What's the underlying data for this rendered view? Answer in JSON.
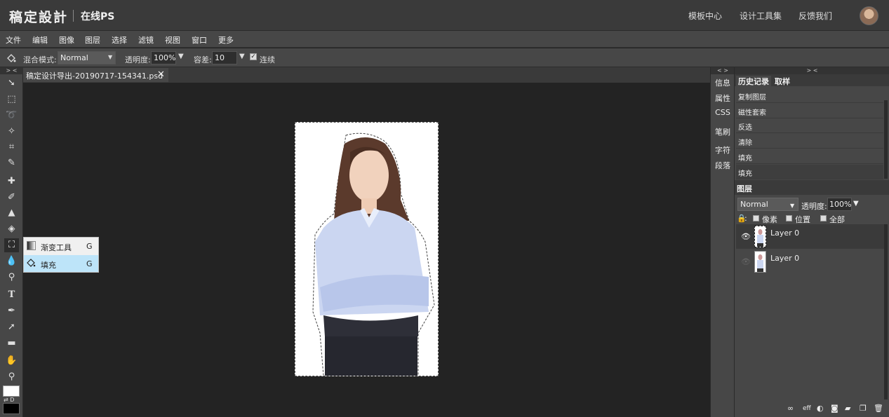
{
  "header": {
    "logo": "稿定設計",
    "subtitle": "在线PS",
    "links": [
      "模板中心",
      "设计工具集",
      "反馈我们"
    ]
  },
  "menu": [
    "文件",
    "编辑",
    "图像",
    "图层",
    "选择",
    "滤镜",
    "视图",
    "窗口",
    "更多"
  ],
  "options": {
    "blend_label": "混合模式:",
    "blend_value": "Normal",
    "opacity_label": "透明度:",
    "opacity_value": "100%",
    "tolerance_label": "容差:",
    "tolerance_value": "10",
    "contiguous_label": "连续",
    "contiguous_checked": true
  },
  "document": {
    "tab_title": "稿定设计导出-20190717-154341.psd"
  },
  "flyout": {
    "items": [
      {
        "label": "渐变工具",
        "shortcut": "G",
        "icon": "gradient-icon",
        "selected": false
      },
      {
        "label": "填充",
        "shortcut": "G",
        "icon": "paint-bucket-icon",
        "selected": true
      }
    ]
  },
  "side_tabs": [
    "信息",
    "属性",
    "CSS",
    "笔刷",
    "字符",
    "段落"
  ],
  "history": {
    "tabs": [
      "历史记录",
      "取样"
    ],
    "items": [
      "复制图层",
      "磁性套索",
      "反选",
      "清除",
      "填充",
      "填充"
    ]
  },
  "layers": {
    "tab": "图层",
    "blend_value": "Normal",
    "opacity_label": "透明度:",
    "opacity_value": "100%",
    "lock_options": [
      "像素",
      "位置",
      "全部"
    ],
    "items": [
      {
        "name": "Layer 0",
        "visible": true
      },
      {
        "name": "Layer 0",
        "visible": false
      }
    ]
  },
  "toolbar": {
    "swatch_labels": "⇄ D",
    "tools": [
      "move-tool-icon",
      "marquee-icon",
      "lasso-icon",
      "magic-wand-icon",
      "crop-icon",
      "eyedropper-icon",
      "healing-brush-icon",
      "brush-icon",
      "clone-stamp-icon",
      "eraser-icon",
      "paint-bucket-icon",
      "blur-icon",
      "dodge-icon",
      "text-icon",
      "pen-icon",
      "path-select-icon",
      "rectangle-icon",
      "hand-icon",
      "zoom-icon"
    ]
  },
  "colors": {
    "accent_selected": "#bde4f9",
    "panel": "#474747",
    "canvas_bg": "#232323"
  }
}
